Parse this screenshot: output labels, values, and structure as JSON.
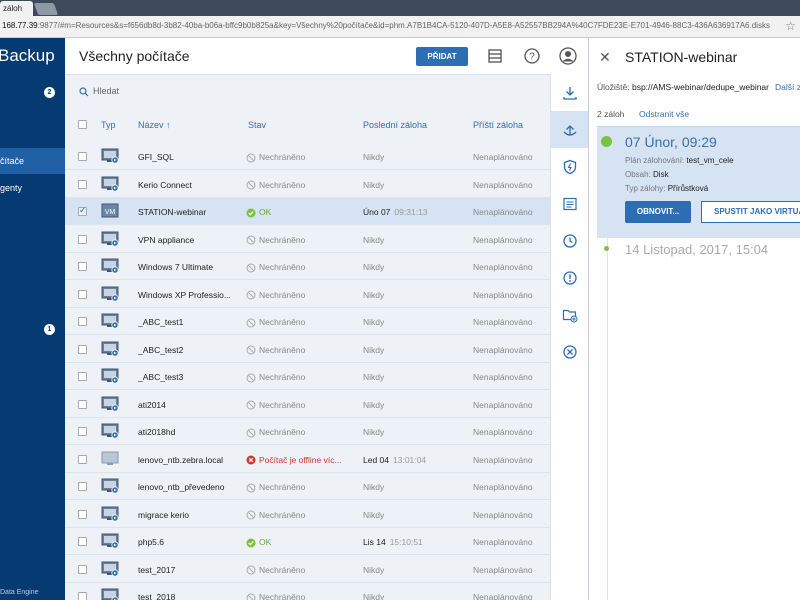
{
  "browser": {
    "tab_title": "záloh",
    "url_host": "168.77.39",
    "url_rest": ":9877/#m=Resources&s=f656db8d-3b82-40ba-b06a-bffc9b0b825a&key=Všechny%20počítače&id=phm.A7B1B4CA-5120-407D-A5E8-A52557BB294A%40C7FDE23E-E701-4946-88C3-436A636917A6.disks"
  },
  "sidebar": {
    "brand": "Backup",
    "badge_top": "2",
    "badge_mid": "1",
    "items": [
      {
        "label": "čítače"
      },
      {
        "label": "genty"
      }
    ],
    "footer": "Data Engine"
  },
  "header": {
    "title": "Všechny počítače",
    "add_label": "PŘIDAT"
  },
  "search": {
    "placeholder": "Hledat"
  },
  "columns": {
    "type": "Typ",
    "name": "Název ↑",
    "status": "Stav",
    "last": "Poslední záloha",
    "next": "Příští záloha"
  },
  "rows": [
    {
      "name": "GFI_SQL",
      "status": "Nechráněno",
      "last": "Nikdy",
      "time": "",
      "next": "Nenaplánováno"
    },
    {
      "name": "Kerio Connect",
      "status": "Nechráněno",
      "last": "Nikdy",
      "time": "",
      "next": "Nenaplánováno"
    },
    {
      "name": "STATION-webinar",
      "status": "OK",
      "last": "Úno 07",
      "time": "09:31:13",
      "next": "Nenaplánováno"
    },
    {
      "name": "VPN appliance",
      "status": "Nechráněno",
      "last": "Nikdy",
      "time": "",
      "next": "Nenaplánováno"
    },
    {
      "name": "Windows 7 Ultimate",
      "status": "Nechráněno",
      "last": "Nikdy",
      "time": "",
      "next": "Nenaplánováno"
    },
    {
      "name": "Windows XP Professio...",
      "status": "Nechráněno",
      "last": "Nikdy",
      "time": "",
      "next": "Nenaplánováno"
    },
    {
      "name": "_ABC_test1",
      "status": "Nechráněno",
      "last": "Nikdy",
      "time": "",
      "next": "Nenaplánováno"
    },
    {
      "name": "_ABC_test2",
      "status": "Nechráněno",
      "last": "Nikdy",
      "time": "",
      "next": "Nenaplánováno"
    },
    {
      "name": "_ABC_test3",
      "status": "Nechráněno",
      "last": "Nikdy",
      "time": "",
      "next": "Nenaplánováno"
    },
    {
      "name": "ati2014",
      "status": "Nechráněno",
      "last": "Nikdy",
      "time": "",
      "next": "Nenaplánováno"
    },
    {
      "name": "ati2018hd",
      "status": "Nechráněno",
      "last": "Nikdy",
      "time": "",
      "next": "Nenaplánováno"
    },
    {
      "name": "lenovo_ntb.zebra.local",
      "status": "Počítač je offline víc...",
      "last": "Led 04",
      "time": "13:01:04",
      "next": "Nenaplánováno"
    },
    {
      "name": "lenovo_ntb_převedeno",
      "status": "Nechráněno",
      "last": "Nikdy",
      "time": "",
      "next": "Nenaplánováno"
    },
    {
      "name": "migrace kerio",
      "status": "Nechráněno",
      "last": "Nikdy",
      "time": "",
      "next": "Nenaplánováno"
    },
    {
      "name": "php5.6",
      "status": "OK",
      "last": "Lis 14",
      "time": "15:10:51",
      "next": "Nenaplánováno"
    },
    {
      "name": "test_2017",
      "status": "Nechráněno",
      "last": "Nikdy",
      "time": "",
      "next": "Nenaplánováno"
    },
    {
      "name": "test_2018",
      "status": "Nechráněno",
      "last": "Nikdy",
      "time": "",
      "next": "Nenaplánováno"
    }
  ],
  "vm_label": "VM",
  "panel": {
    "title": "STATION-webinar",
    "storage_label": "Úložiště:",
    "storage_value": "bsp://AMS-webinar/dedupe_webinar",
    "more": "Další z",
    "count": "2 záloh",
    "remove_all": "Odstranit vše",
    "backup1": {
      "date": "07 Únor, 09:29",
      "plan_label": "Plán zálohování:",
      "plan_value": "test_vm_cele",
      "content_label": "Obsah:",
      "content_value": "Disk",
      "type_label": "Typ zálohy:",
      "type_value": "Přírůstková",
      "restore": "OBNOVIT...",
      "run_vm": "SPUSTIT JAKO VIRTUÁL"
    },
    "backup2": {
      "date": "14 Listopad, 2017, 15:04"
    }
  }
}
